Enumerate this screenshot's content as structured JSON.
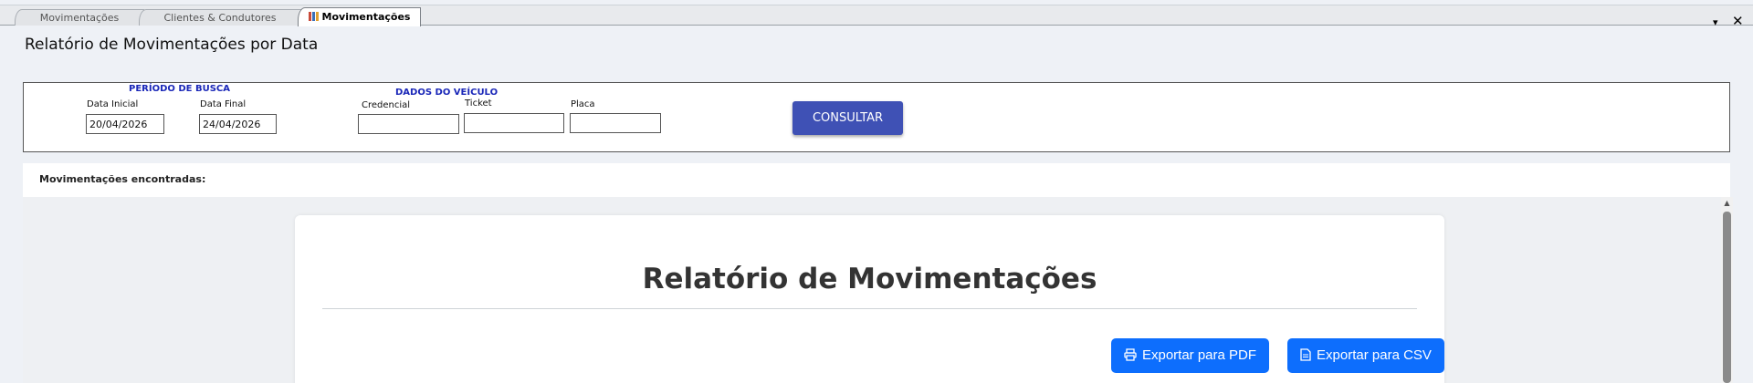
{
  "tabs": [
    {
      "label": "Movimentações"
    },
    {
      "label": "Clientes & Condutores"
    },
    {
      "label": "Movimentações"
    }
  ],
  "window_controls": {
    "dropdown": "▾",
    "close": "✕"
  },
  "page": {
    "title": "Relatório de Movimentações por Data"
  },
  "filters": {
    "period_title": "PERÍODO DE BUSCA",
    "start_label": "Data Inicial",
    "start_value": "20/04/2026",
    "end_label": "Data Final",
    "end_value": "24/04/2026",
    "vehicle_title": "DADOS DO VEÍCULO",
    "credential_label": "Credencial",
    "credential_value": "",
    "ticket_label": "Ticket",
    "ticket_value": "",
    "plate_label": "Placa",
    "plate_value": "",
    "submit_label": "CONSULTAR"
  },
  "results": {
    "label": "Movimentações encontradas:"
  },
  "report": {
    "title": "Relatório de Movimentações",
    "export_pdf": "Exportar para PDF",
    "export_csv": "Exportar para CSV"
  },
  "colors": {
    "accent": "#3f51b5",
    "export": "#0d6efd",
    "group_title": "#1a27b8"
  }
}
